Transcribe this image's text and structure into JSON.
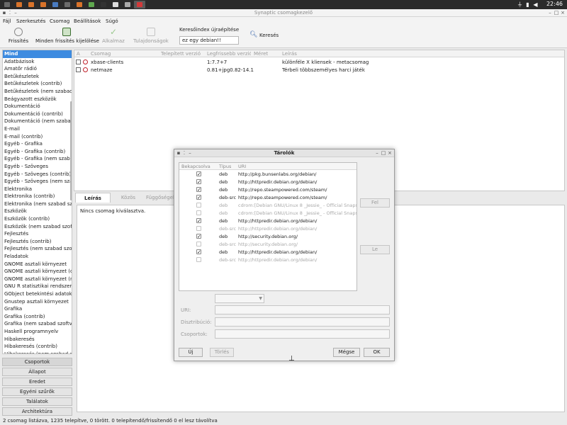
{
  "panel": {
    "clock": "22:46",
    "tasks": [
      {
        "color": "#6a6a6a"
      },
      {
        "color": "#d9732a"
      },
      {
        "color": "#d9732a"
      },
      {
        "color": "#d9732a"
      },
      {
        "color": "#4a7bc0"
      },
      {
        "color": "#6b6b6b"
      },
      {
        "color": "#d9732a"
      },
      {
        "color": "#5fa84f"
      },
      {
        "color": "#333333"
      },
      {
        "color": "#dddddd"
      },
      {
        "color": "#aaaaaa"
      },
      {
        "color": "#d23a3a"
      }
    ]
  },
  "window": {
    "title": "Synaptic csomagkezelő"
  },
  "menu": {
    "items": [
      "Fájl",
      "Szerkesztés",
      "Csomag",
      "Beállítások",
      "Súgó"
    ]
  },
  "toolbar": {
    "refresh": "Frissítés",
    "mark_all": "Minden frissítés kijelölése",
    "apply": "Alkalmaz",
    "properties": "Tulajdonságok",
    "search_index_label": "Keresőindex újraépítése",
    "search_value": "ez egy debian!!",
    "search": "Keresés"
  },
  "sidebar": {
    "categories": [
      "Mind",
      "Adatbázisok",
      "Amatőr rádió",
      "Betűkészletek",
      "Betűkészletek (contrib)",
      "Betűkészletek (nem szabad)",
      "Beágyazott eszközök",
      "Dokumentáció",
      "Dokumentáció (contrib)",
      "Dokumentáció (nem szabad)",
      "E-mail",
      "E-mail (contrib)",
      "Egyéb - Grafika",
      "Egyéb - Grafika (contrib)",
      "Egyéb - Grafika (nem szabad)",
      "Egyéb - Szöveges",
      "Egyéb - Szöveges (contrib)",
      "Egyéb - Szöveges (nem szabad)",
      "Elektronika",
      "Elektronika (contrib)",
      "Elektronika (nem szabad szoftver)",
      "Eszközök",
      "Eszközök (contrib)",
      "Eszközök (nem szabad szoftver)",
      "Fejlesztés",
      "Fejlesztés (contrib)",
      "Fejlesztés (nem szabad szoftver)",
      "Feladatok",
      "GNOME asztali környezet",
      "GNOME asztali környezet (contrib)",
      "GNOME asztali környezet (nem szabad)",
      "GNU R statisztikai rendszer",
      "GObject betekintési adatok",
      "Gnustep asztali környezet",
      "Grafika",
      "Grafika (contrib)",
      "Grafika (nem szabad szoftver)",
      "Haskell programnyelv",
      "Hibakeresés",
      "Hibakeresés (contrib)",
      "Hibakeresés (nem szabad szoftver)"
    ],
    "filters": [
      "Csoportok",
      "Állapot",
      "Eredet",
      "Egyéni szűrők",
      "Találatok",
      "Architektúra"
    ]
  },
  "packages": {
    "columns": [
      "A",
      "Csomag",
      "Telepített verzió",
      "Legfrissebb verzió",
      "Méret",
      "Leírás"
    ],
    "rows": [
      {
        "name": "xbase-clients",
        "installed": "",
        "latest": "1:7.7+7",
        "size": "",
        "desc": "különféle X kliensek - metacsomag"
      },
      {
        "name": "netmaze",
        "installed": "",
        "latest": "0.81+jpg0.82-14.1",
        "size": "",
        "desc": "Térbeli többszemélyes harci játék"
      }
    ]
  },
  "details": {
    "tabs": [
      "Leírás",
      "Közös",
      "Függőségek"
    ],
    "text": "Nincs csomag kiválasztva."
  },
  "status": "2 csomag listázva, 1235 telepítve, 0 törött. 0 telepítendő/frissítendő 0 el lesz távolítva",
  "dialog": {
    "title": "Tárolók",
    "columns": [
      "Bekapcsolva",
      "Típus",
      "URI"
    ],
    "repos": [
      {
        "enabled": true,
        "type": "deb",
        "uri": "http://pkg.bunsenlabs.org/debian/"
      },
      {
        "enabled": true,
        "type": "deb",
        "uri": "http://httpredir.debian.org/debian/"
      },
      {
        "enabled": true,
        "type": "deb",
        "uri": "http://repo.steampowered.com/steam/"
      },
      {
        "enabled": true,
        "type": "deb-src",
        "uri": "http://repo.steampowered.com/steam/"
      },
      {
        "enabled": false,
        "type": "deb",
        "uri": "cdrom:[Debian GNU/Linux 8 _Jessie_ - Official Snapshot"
      },
      {
        "enabled": false,
        "type": "deb",
        "uri": "cdrom:[Debian GNU/Linux 8 _Jessie_ - Official Snapshot"
      },
      {
        "enabled": true,
        "type": "deb",
        "uri": "http://httpredir.debian.org/debian/"
      },
      {
        "enabled": false,
        "type": "deb-src",
        "uri": "http://httpredir.debian.org/debian/"
      },
      {
        "enabled": true,
        "type": "deb",
        "uri": "http://security.debian.org/"
      },
      {
        "enabled": false,
        "type": "deb-src",
        "uri": "http://security.debian.org/"
      },
      {
        "enabled": true,
        "type": "deb",
        "uri": "http://httpredir.debian.org/debian/"
      },
      {
        "enabled": false,
        "type": "deb-src",
        "uri": "http://httpredir.debian.org/debian/"
      }
    ],
    "up": "Fel",
    "down": "Le",
    "uri_label": "URI:",
    "dist_label": "Disztribúció:",
    "sections_label": "Csoportok:",
    "new": "Új",
    "delete": "Törlés",
    "cancel": "Mégse",
    "ok": "OK"
  }
}
